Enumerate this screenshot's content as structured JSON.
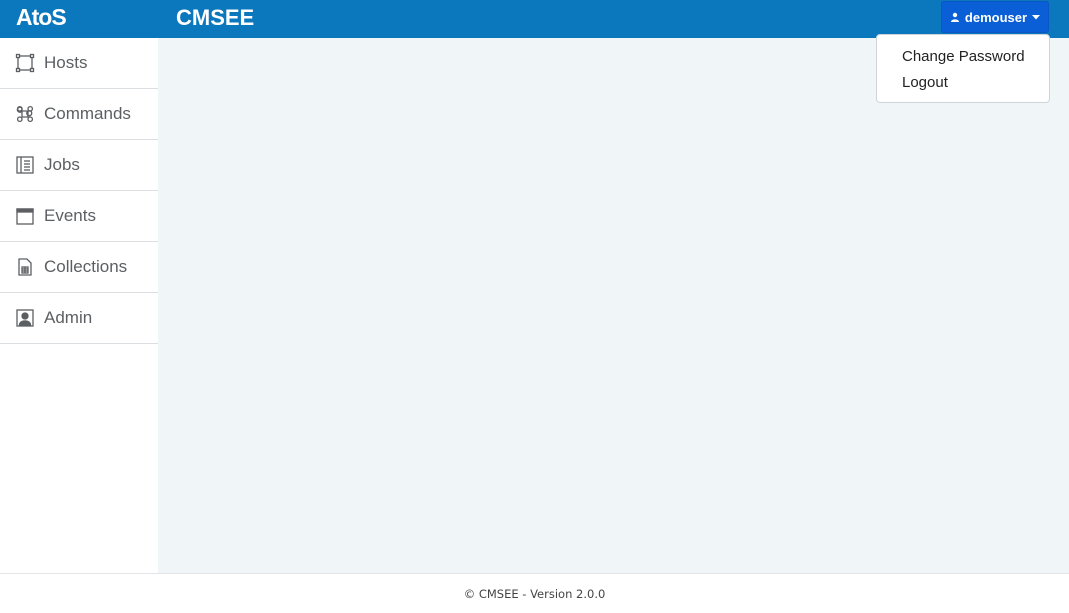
{
  "header": {
    "logo_text": "AtoS",
    "app_title": "CMSEE",
    "user_menu": {
      "username": "demouser",
      "icon": "user-icon",
      "items": [
        {
          "label": "Change Password"
        },
        {
          "label": "Logout"
        }
      ]
    },
    "colors": {
      "bar": "#0b77bd",
      "user_button": "#0a5fd6"
    }
  },
  "sidebar": {
    "items": [
      {
        "label": "Hosts",
        "icon": "hosts-icon"
      },
      {
        "label": "Commands",
        "icon": "command-icon"
      },
      {
        "label": "Jobs",
        "icon": "jobs-icon"
      },
      {
        "label": "Events",
        "icon": "calendar-icon"
      },
      {
        "label": "Collections",
        "icon": "collections-icon"
      },
      {
        "label": "Admin",
        "icon": "admin-icon"
      }
    ]
  },
  "footer": {
    "text": "© CMSEE - Version 2.0.0"
  }
}
